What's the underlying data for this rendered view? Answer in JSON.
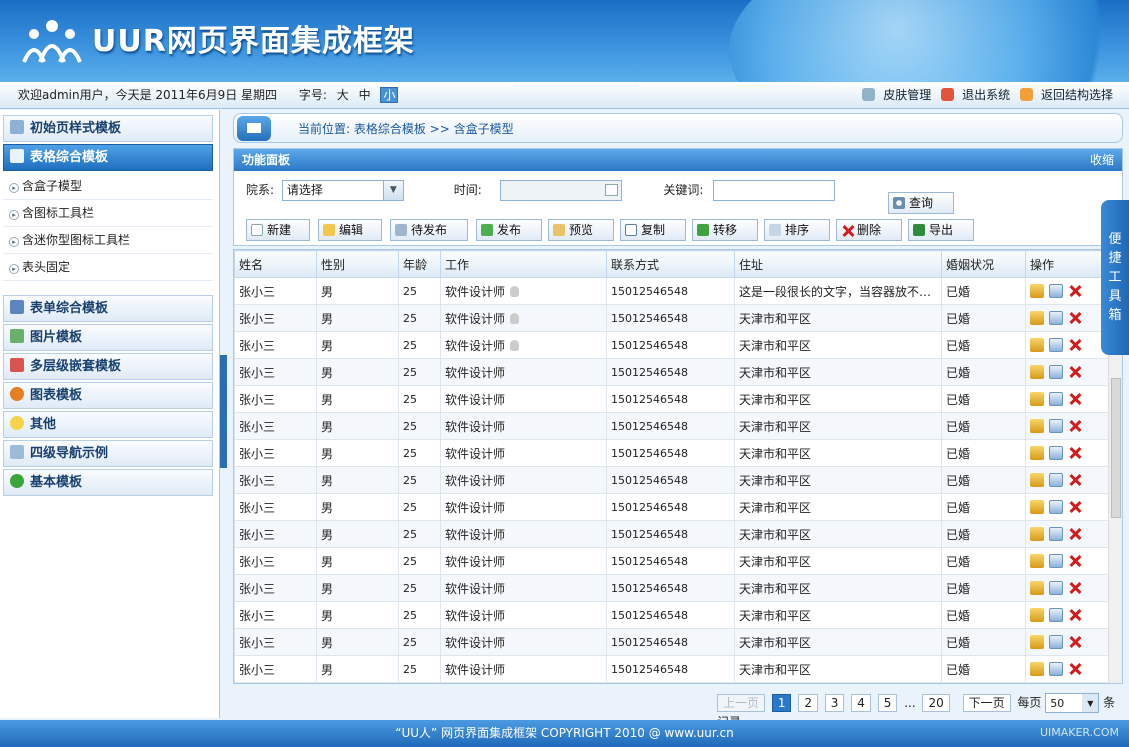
{
  "header": {
    "title": "UUR网页界面集成框架"
  },
  "infobar": {
    "welcome": "欢迎admin用户，今天是 2011年6月9日 星期四",
    "font_label": "字号:",
    "font_sizes": [
      "大",
      "中",
      "小"
    ],
    "links": [
      "皮肤管理",
      "退出系统",
      "返回结构选择"
    ]
  },
  "sidebar": {
    "top_items": [
      "初始页样式模板",
      "表格综合模板"
    ],
    "sub_items": [
      "含盒子模型",
      "含图标工具栏",
      "含迷你型图标工具栏",
      "表头固定"
    ],
    "bottom_items": [
      "表单综合模板",
      "图片模板",
      "多层级嵌套模板",
      "图表模板",
      "其他",
      "四级导航示例",
      "基本模板"
    ]
  },
  "breadcrumb": {
    "text": "当前位置: 表格综合模板 >> 含盒子模型"
  },
  "panel": {
    "title": "功能面板",
    "collapse": "收缩",
    "dept_label": "院系:",
    "dept_value": "请选择",
    "time_label": "时间:",
    "keyword_label": "关键词:",
    "search": "查询",
    "buttons": [
      "新建",
      "编辑",
      "待发布",
      "发布",
      "预览",
      "复制",
      "转移",
      "排序",
      "删除",
      "导出"
    ]
  },
  "table": {
    "headers": [
      "姓名",
      "性别",
      "年龄",
      "工作",
      "联系方式",
      "住址",
      "婚姻状况",
      "操作"
    ],
    "rows": [
      [
        "张小三",
        "男",
        "25",
        "软件设计师",
        "15012546548",
        "这是一段很长的文字，当容器放不下时",
        "已婚"
      ],
      [
        "张小三",
        "男",
        "25",
        "软件设计师",
        "15012546548",
        "天津市和平区",
        "已婚"
      ],
      [
        "张小三",
        "男",
        "25",
        "软件设计师",
        "15012546548",
        "天津市和平区",
        "已婚"
      ],
      [
        "张小三",
        "男",
        "25",
        "软件设计师",
        "15012546548",
        "天津市和平区",
        "已婚"
      ],
      [
        "张小三",
        "男",
        "25",
        "软件设计师",
        "15012546548",
        "天津市和平区",
        "已婚"
      ],
      [
        "张小三",
        "男",
        "25",
        "软件设计师",
        "15012546548",
        "天津市和平区",
        "已婚"
      ],
      [
        "张小三",
        "男",
        "25",
        "软件设计师",
        "15012546548",
        "天津市和平区",
        "已婚"
      ],
      [
        "张小三",
        "男",
        "25",
        "软件设计师",
        "15012546548",
        "天津市和平区",
        "已婚"
      ],
      [
        "张小三",
        "男",
        "25",
        "软件设计师",
        "15012546548",
        "天津市和平区",
        "已婚"
      ],
      [
        "张小三",
        "男",
        "25",
        "软件设计师",
        "15012546548",
        "天津市和平区",
        "已婚"
      ],
      [
        "张小三",
        "男",
        "25",
        "软件设计师",
        "15012546548",
        "天津市和平区",
        "已婚"
      ],
      [
        "张小三",
        "男",
        "25",
        "软件设计师",
        "15012546548",
        "天津市和平区",
        "已婚"
      ],
      [
        "张小三",
        "男",
        "25",
        "软件设计师",
        "15012546548",
        "天津市和平区",
        "已婚"
      ],
      [
        "张小三",
        "男",
        "25",
        "软件设计师",
        "15012546548",
        "天津市和平区",
        "已婚"
      ],
      [
        "张小三",
        "男",
        "25",
        "软件设计师",
        "15012546548",
        "天津市和平区",
        "已婚"
      ]
    ]
  },
  "pager": {
    "prev": "上一页",
    "pages": [
      "1",
      "2",
      "3",
      "4",
      "5"
    ],
    "ellipsis": "...",
    "last": "20",
    "next": "下一页",
    "per_page_label": "每页",
    "per_page": "50",
    "unit": "条记录"
  },
  "toolbox": {
    "label": "便捷工具箱"
  },
  "footer": {
    "text": "“UU人” 网页界面集成框架 COPYRIGHT 2010 @ www.uur.cn",
    "watermark": "UIMAKER.COM"
  }
}
